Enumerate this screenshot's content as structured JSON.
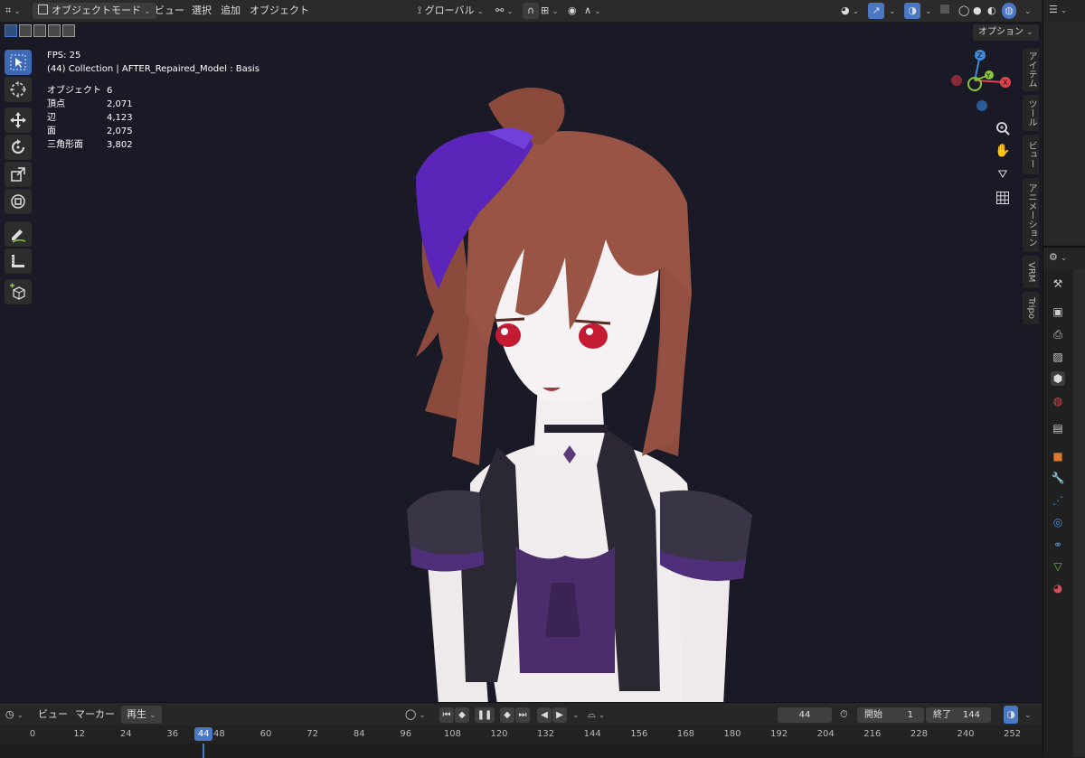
{
  "header": {
    "mode_label": "オブジェクトモード",
    "menus": [
      "ビュー",
      "選択",
      "追加",
      "オブジェクト"
    ],
    "transform_orientation": "グローバル",
    "options_label": "オプション"
  },
  "viewport": {
    "stats": {
      "fps": "FPS: 25",
      "collection": "(44) Collection | AFTER_Repaired_Model : Basis",
      "rows": [
        {
          "label": "オブジェクト",
          "value": "6"
        },
        {
          "label": "頂点",
          "value": "2,071"
        },
        {
          "label": "辺",
          "value": "4,123"
        },
        {
          "label": "面",
          "value": "2,075"
        },
        {
          "label": "三角形面",
          "value": "3,802"
        }
      ]
    },
    "gizmo": {
      "z": "Z",
      "y": "Y",
      "x": "X"
    },
    "side_tabs": [
      "アイテム",
      "ツール",
      "ビュー",
      "アニメーション",
      "VRM",
      "Tripo"
    ]
  },
  "timeline": {
    "menus": [
      "ビュー",
      "マーカー"
    ],
    "playback_label": "再生",
    "current_frame": "44",
    "start_label": "開始",
    "start_value": "1",
    "end_label": "終了",
    "end_value": "144",
    "ruler": [
      "0",
      "12",
      "24",
      "36",
      "48",
      "60",
      "72",
      "84",
      "96",
      "108",
      "120",
      "132",
      "144",
      "156",
      "168",
      "180",
      "192",
      "204",
      "216",
      "228",
      "240",
      "252"
    ],
    "playhead": "44"
  },
  "colors": {
    "accent": "#4a78c4",
    "viewport_bg": "#1a1a26",
    "axis_x": "#e2424f",
    "axis_y": "#8ac53a",
    "axis_z": "#3f8ad8"
  }
}
